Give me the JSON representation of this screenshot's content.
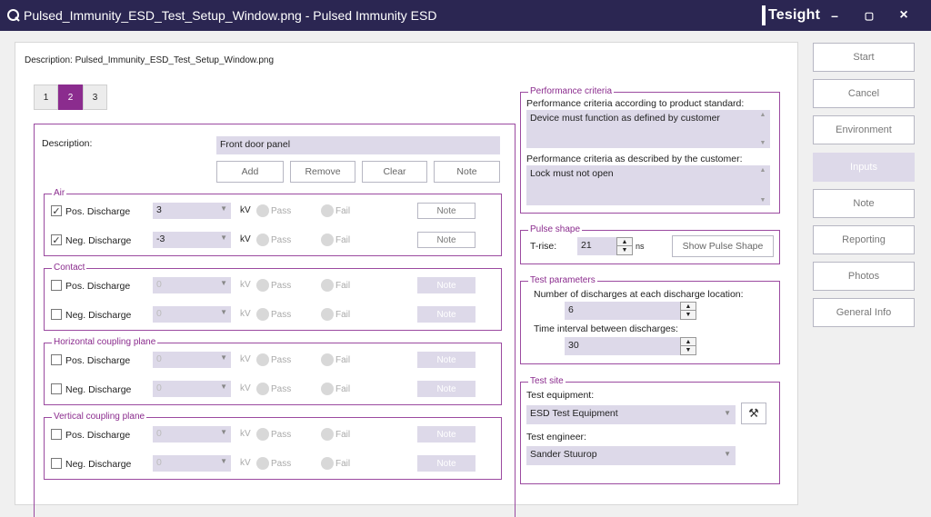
{
  "window": {
    "title": "Pulsed_Immunity_ESD_Test_Setup_Window.png - Pulsed Immunity ESD",
    "app_icon": "q-logo-icon",
    "brand": "Tesight",
    "controls": {
      "minimize": "–",
      "maximize": "▢",
      "close": "×"
    }
  },
  "description_line": "Description: Pulsed_Immunity_ESD_Test_Setup_Window.png",
  "tabs": [
    {
      "label": "1"
    },
    {
      "label": "2"
    },
    {
      "label": "3"
    }
  ],
  "active_tab": "2",
  "form": {
    "description_label": "Description:",
    "description_value": "Front door panel",
    "buttons": {
      "add": "Add",
      "remove": "Remove",
      "clear": "Clear",
      "note": "Note"
    }
  },
  "common": {
    "unit": "kV",
    "pass": "Pass",
    "fail": "Fail",
    "note": "Note",
    "pos_label": "Pos. Discharge",
    "neg_label": "Neg. Discharge",
    "disabled_value": "0"
  },
  "groups": {
    "air": {
      "title": "Air",
      "pos": {
        "checked": true,
        "value": "3"
      },
      "neg": {
        "checked": true,
        "value": "-3"
      }
    },
    "contact": {
      "title": "Contact"
    },
    "horizontal": {
      "title": "Horizontal coupling plane"
    },
    "vertical": {
      "title": "Vertical coupling plane"
    }
  },
  "performance": {
    "title": "Performance criteria",
    "standard_label": "Performance criteria according to product standard:",
    "standard_value": "Device must function as defined by customer",
    "customer_label": "Performance criteria as described by the customer:",
    "customer_value": "Lock must not open"
  },
  "pulse_shape": {
    "title": "Pulse shape",
    "trise_label": "T-rise:",
    "trise_value": "21",
    "trise_unit": "ns",
    "show_button": "Show Pulse Shape"
  },
  "test_parameters": {
    "title": "Test parameters",
    "discharges_label": "Number of discharges at each discharge location:",
    "discharges_value": "6",
    "interval_label": "Time interval between discharges:",
    "interval_value": "30"
  },
  "test_site": {
    "title": "Test site",
    "equipment_label": "Test equipment:",
    "equipment_value": "ESD Test Equipment",
    "engineer_label": "Test engineer:",
    "engineer_value": "Sander Stuurop",
    "tools_icon": "tools-icon"
  },
  "side_buttons": [
    {
      "label": "Start",
      "enabled": true
    },
    {
      "label": "Cancel",
      "enabled": true
    },
    {
      "label": "Environment",
      "enabled": true
    },
    {
      "label": "Inputs",
      "enabled": false
    },
    {
      "label": "Note",
      "enabled": true
    },
    {
      "label": "Reporting",
      "enabled": true
    },
    {
      "label": "Photos",
      "enabled": true
    },
    {
      "label": "General Info",
      "enabled": true
    }
  ]
}
